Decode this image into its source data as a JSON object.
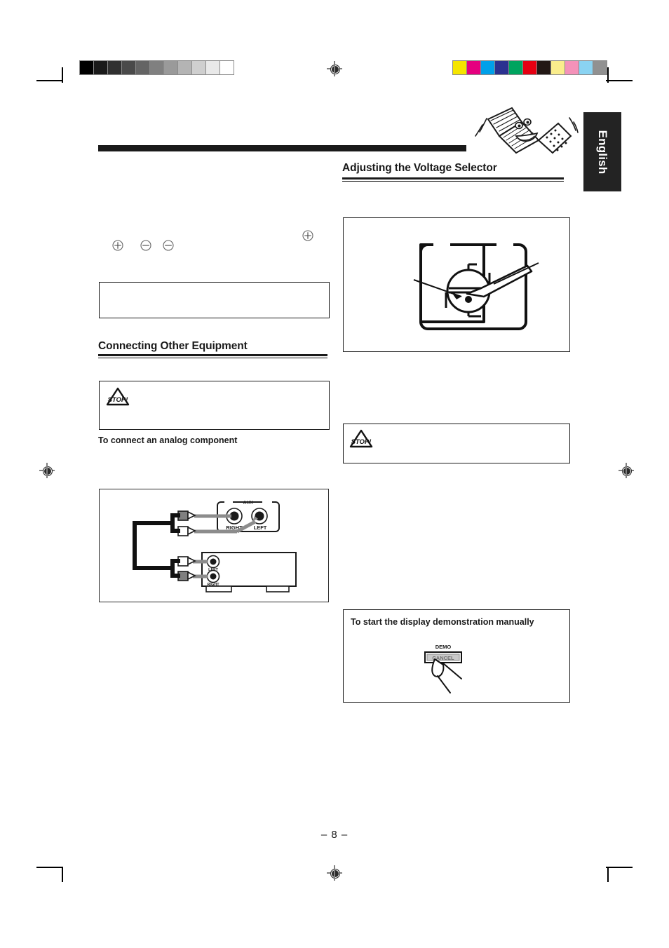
{
  "page": {
    "number_label": "– 8 –",
    "language_tab": "English"
  },
  "calibration": {
    "grayscale_label": "grayscale-calibration-strip",
    "grayscale_steps": [
      "#000000",
      "#1a1a1a",
      "#303030",
      "#4a4a4a",
      "#646464",
      "#808080",
      "#9a9a9a",
      "#b4b4b4",
      "#cfcfcf",
      "#e9e9e9",
      "#ffffff"
    ],
    "color_label": "color-calibration-strip",
    "color_steps": [
      "#f5e500",
      "#e5007f",
      "#00a0e9",
      "#2b3190",
      "#00a košt",
      "#e60012",
      "#231815",
      "#faed8c",
      "#f492b9",
      "#8ad3f2",
      "#919191"
    ],
    "color_steps_fixed": [
      "#f5e500",
      "#e5007f",
      "#00a0e9",
      "#2b3190",
      "#00a45f",
      "#e60012",
      "#231815",
      "#faed8c",
      "#f492b9",
      "#8ad3f2",
      "#919191"
    ]
  },
  "left_column": {
    "bullets": [
      {
        "symbol": "plus-circle",
        "text": ""
      },
      {
        "symbol": "minus-circle",
        "text": ""
      },
      {
        "symbol": "minus-circle",
        "text": ""
      }
    ],
    "note_box": {
      "text": ""
    },
    "heading": "Connecting Other Equipment",
    "caution_box": {
      "icon_label": "STOP!",
      "text": ""
    },
    "subheading": "To connect an analog component",
    "figure": {
      "name": "analog-connection-diagram",
      "aux_panel_label": "AUX",
      "aux_jacks": [
        "RIGHT",
        "LEFT"
      ],
      "component_jacks": [
        "LEFT",
        "RIGHT"
      ]
    }
  },
  "right_column": {
    "heading": "Adjusting the Voltage Selector",
    "top_bullet": {
      "symbol": "plus-circle",
      "text": ""
    },
    "figure_voltage": {
      "name": "voltage-selector-screwdriver-diagram"
    },
    "caution_box": {
      "icon_label": "STOP!",
      "text": ""
    },
    "demo_box": {
      "heading": "To start the display demonstration manually",
      "button_top_label": "DEMO",
      "button_label": "CANCEL"
    }
  }
}
